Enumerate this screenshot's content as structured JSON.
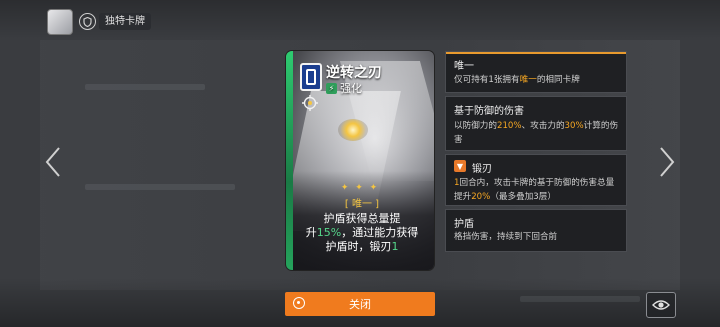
{
  "topbar": {
    "tag_label": "独特卡牌"
  },
  "card": {
    "title": "逆转之刃",
    "type": "强化",
    "stars": "✦ ✦ ✦",
    "keyword": "[ 唯一 ]",
    "desc_1": "护盾获得总量提",
    "desc_2a": "升",
    "desc_2b": "15%",
    "desc_2c": "，通过能力获得",
    "desc_3a": "护盾时，锻刃",
    "desc_3b": "1"
  },
  "panels": {
    "unique": {
      "title": "唯一",
      "t1": "仅可持有1张拥有",
      "t2": "唯一",
      "t3": "的相同卡牌"
    },
    "defense": {
      "title": "基于防御的伤害",
      "t1": "以防御力的",
      "t2": "210%",
      "t3": "、攻击力的",
      "t4": "30%",
      "t5": "计算的伤害"
    },
    "forge": {
      "title": "锻刃",
      "t1": "1",
      "t2": "回合内，攻击卡牌的基于防御的伤害总量提升",
      "t3": "20%",
      "t4": "（最多叠加3层）"
    },
    "shield": {
      "title": "护盾",
      "text": "格挡伤害，持续到下回合前"
    }
  },
  "bottom": {
    "close_label": "关闭"
  },
  "colors": {
    "accent": "#f07b1e",
    "keyword": "#f4c542",
    "enhance": "#2f9e5b",
    "number": "#f5a623"
  },
  "icons": [
    "avatar",
    "shield-icon",
    "prev-arrow-icon",
    "next-arrow-icon",
    "cost-icon",
    "target-icon",
    "blade-icon",
    "close-circle-icon",
    "eye-icon"
  ]
}
